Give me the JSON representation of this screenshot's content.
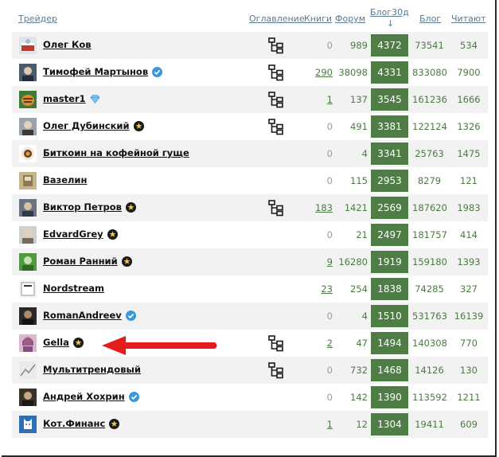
{
  "header": {
    "trader": "Трейдер",
    "toc": "Оглавление",
    "books": "Книги",
    "forum": "Форум",
    "blog30": "Блог30д",
    "sort_arrow": "↓",
    "blog": "Блог",
    "readers": "Читают"
  },
  "colors": {
    "accent_green": "#4e7d45",
    "text_green": "#4c7b43",
    "header_link": "#5a7a91",
    "row_stripe": "#f2f2f2",
    "arrow_red": "#e51c1c"
  },
  "rows": [
    {
      "name": "Олег Ков",
      "badge": "",
      "has_toc": true,
      "books": "0",
      "forum": "989",
      "blog30": "4372",
      "blog": "73541",
      "readers": "534"
    },
    {
      "name": "Тимофей Мартынов",
      "badge": "check-badge-icon",
      "has_toc": true,
      "books": "290",
      "forum": "38098",
      "blog30": "4331",
      "blog": "833080",
      "readers": "7900"
    },
    {
      "name": "master1",
      "badge": "diamond-icon",
      "has_toc": true,
      "books": "1",
      "forum": "137",
      "blog30": "3545",
      "blog": "161236",
      "readers": "1666"
    },
    {
      "name": "Олег Дубинский",
      "badge": "star-badge-icon",
      "has_toc": true,
      "books": "0",
      "forum": "491",
      "blog30": "3381",
      "blog": "122124",
      "readers": "1326"
    },
    {
      "name": "Биткоин на кофейной гуще",
      "badge": "",
      "has_toc": false,
      "books": "0",
      "forum": "4",
      "blog30": "3341",
      "blog": "25763",
      "readers": "1475"
    },
    {
      "name": "Вазелин",
      "badge": "",
      "has_toc": false,
      "books": "0",
      "forum": "115",
      "blog30": "2953",
      "blog": "8279",
      "readers": "121"
    },
    {
      "name": "Виктор Петров",
      "badge": "star-badge-icon",
      "has_toc": true,
      "books": "183",
      "forum": "1421",
      "blog30": "2569",
      "blog": "187620",
      "readers": "1983"
    },
    {
      "name": "EdvardGrey",
      "badge": "star-badge-icon",
      "has_toc": false,
      "books": "0",
      "forum": "21",
      "blog30": "2497",
      "blog": "181757",
      "readers": "414"
    },
    {
      "name": "Роман Ранний",
      "badge": "star-badge-icon",
      "has_toc": false,
      "books": "9",
      "forum": "16280",
      "blog30": "1919",
      "blog": "159180",
      "readers": "1393"
    },
    {
      "name": "Nordstream",
      "badge": "",
      "has_toc": false,
      "books": "23",
      "forum": "254",
      "blog30": "1838",
      "blog": "74285",
      "readers": "327"
    },
    {
      "name": "RomanAndreev",
      "badge": "check-badge-icon",
      "has_toc": false,
      "books": "0",
      "forum": "4",
      "blog30": "1510",
      "blog": "531763",
      "readers": "16139"
    },
    {
      "name": "Gella",
      "badge": "star-badge-icon",
      "has_toc": true,
      "books": "2",
      "forum": "47",
      "blog30": "1494",
      "blog": "140308",
      "readers": "770"
    },
    {
      "name": "Мультитрендовый",
      "badge": "",
      "has_toc": true,
      "books": "0",
      "forum": "732",
      "blog30": "1468",
      "blog": "14126",
      "readers": "130"
    },
    {
      "name": "Андрей Хохрин",
      "badge": "check-badge-icon",
      "has_toc": false,
      "books": "0",
      "forum": "142",
      "blog30": "1390",
      "blog": "113592",
      "readers": "1211"
    },
    {
      "name": "Кот.Финанс",
      "badge": "star-badge-icon",
      "has_toc": false,
      "books": "1",
      "forum": "12",
      "blog30": "1304",
      "blog": "19411",
      "readers": "609"
    }
  ]
}
